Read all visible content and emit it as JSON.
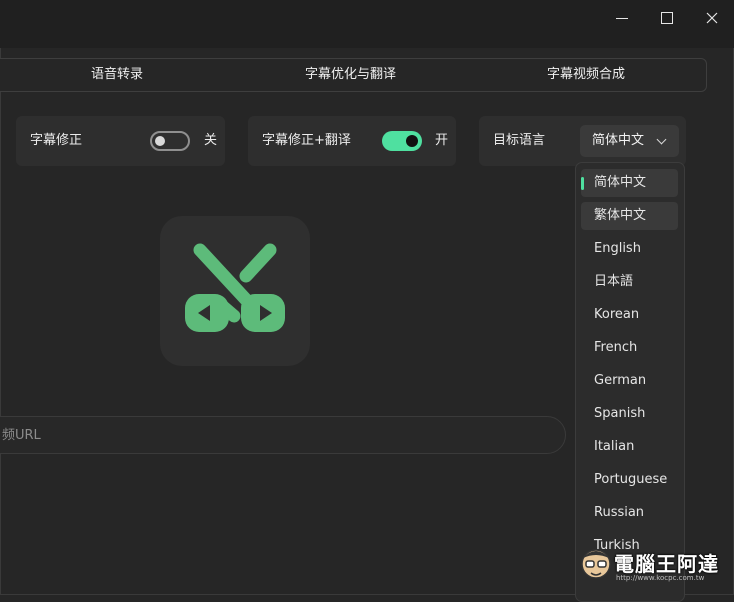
{
  "window_controls": {
    "minimize": "minimize",
    "maximize": "maximize",
    "close": "close"
  },
  "tabs": [
    {
      "label": "语音转录"
    },
    {
      "label": "字幕优化与翻译"
    },
    {
      "label": "字幕视频合成"
    }
  ],
  "options": {
    "subtitle_correction": {
      "label": "字幕修正",
      "state_text": "关",
      "on": false
    },
    "correction_translate": {
      "label": "字幕修正+翻译",
      "state_text": "开",
      "on": true
    },
    "target_language": {
      "label": "目标语言",
      "selected": "简体中文"
    }
  },
  "url_input": {
    "placeholder": "频URL"
  },
  "language_dropdown": {
    "items": [
      {
        "label": "简体中文"
      },
      {
        "label": "繁体中文"
      },
      {
        "label": "English"
      },
      {
        "label": "日本語"
      },
      {
        "label": "Korean"
      },
      {
        "label": "French"
      },
      {
        "label": "German"
      },
      {
        "label": "Spanish"
      },
      {
        "label": "Italian"
      },
      {
        "label": "Portuguese"
      },
      {
        "label": "Russian"
      },
      {
        "label": "Turkish"
      }
    ]
  },
  "watermark": {
    "text": "電腦王阿達",
    "sub": "http://www.kocpc.com.tw"
  },
  "colors": {
    "accent": "#4fe0a0",
    "logo_green": "#5dbb7a",
    "background": "#262626"
  }
}
